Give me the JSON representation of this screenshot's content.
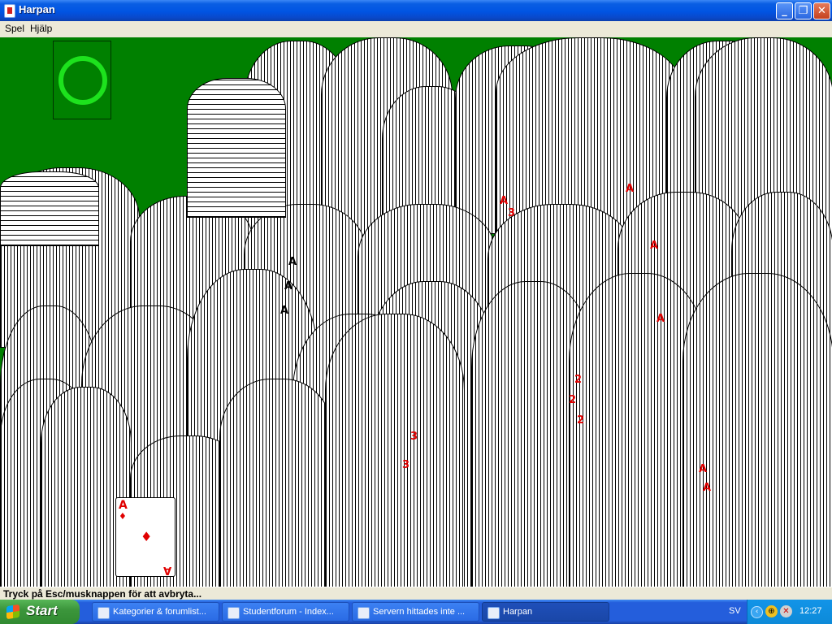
{
  "window": {
    "title": "Harpan",
    "minimize_glyph": "_",
    "maximize_glyph": "❐",
    "close_glyph": "✕"
  },
  "menu": {
    "items": [
      "Spel",
      "Hjälp"
    ]
  },
  "game": {
    "status_text": "Tryck på Esc/musknappen för att avbryta...",
    "ace_card": {
      "rank": "A",
      "suit": "♦"
    },
    "colors": {
      "felt": "#008000",
      "ring": "#1de21d",
      "red_suit": "#e00000"
    }
  },
  "taskbar": {
    "start_label": "Start",
    "tasks": [
      {
        "label": "Kategorier & forumlist...",
        "active": false
      },
      {
        "label": "Studentforum - Index...",
        "active": false
      },
      {
        "label": "Servern hittades inte ...",
        "active": false
      },
      {
        "label": "Harpan",
        "active": true
      }
    ],
    "language": "SV",
    "clock": "12:27"
  }
}
